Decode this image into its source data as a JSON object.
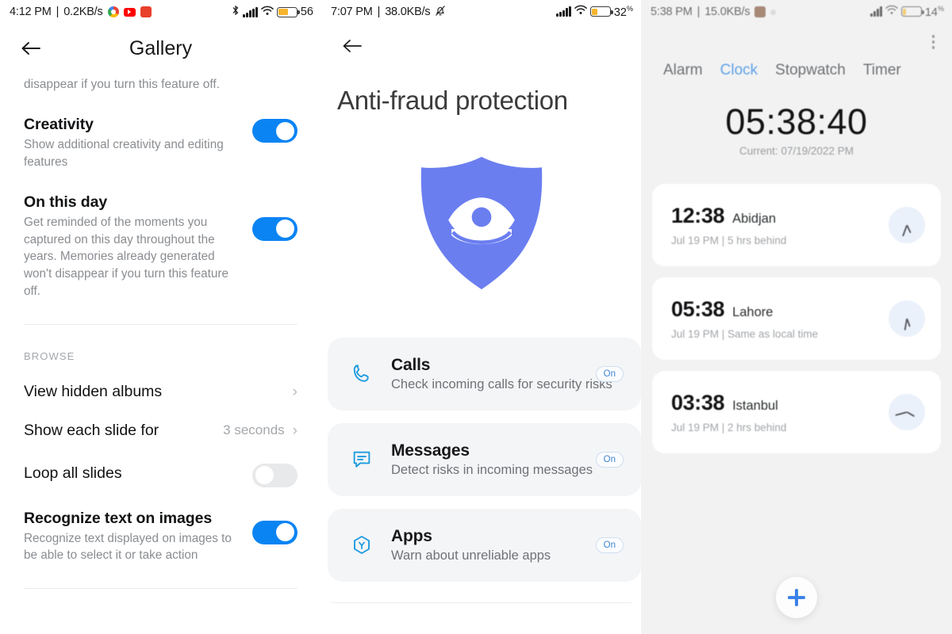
{
  "panel_gallery": {
    "status_bar": {
      "time": "4:12 PM",
      "separator": "|",
      "net_speed": "0.2KB/s",
      "app_icons": [
        "chrome-icon",
        "youtube-icon",
        "red-app-icon"
      ],
      "bluetooth_icon": "bluetooth-icon",
      "signal_icon": "signal-bars-icon",
      "wifi_icon": "wifi-icon",
      "battery_icon": "battery-icon",
      "battery_percent": "56"
    },
    "app_bar": {
      "back_icon": "back-arrow-icon",
      "title": "Gallery"
    },
    "lead_text": "disappear if you turn this feature off.",
    "settings": [
      {
        "title": "Creativity",
        "subtitle": "Show additional creativity and editing features",
        "toggle": "on"
      },
      {
        "title": "On this day",
        "subtitle": "Get reminded of the moments you captured on this day throughout the years. Memories already generated won't disappear if you turn this feature off.",
        "toggle": "on"
      }
    ],
    "section_label": "BROWSE",
    "browse_rows": [
      {
        "title": "View hidden albums",
        "value": "",
        "chevron": "›",
        "type": "nav"
      },
      {
        "title": "Show each slide for",
        "value": "3 seconds",
        "chevron": "›",
        "type": "nav"
      },
      {
        "title": "Loop all slides",
        "value": "",
        "chevron": "",
        "type": "toggle",
        "toggle": "off"
      }
    ],
    "last_setting": {
      "title": "Recognize text on images",
      "subtitle": "Recognize text displayed on images to be able to select it or take action",
      "toggle": "on"
    }
  },
  "panel_antifraud": {
    "status_bar": {
      "time": "7:07 PM",
      "separator": "|",
      "net_speed": "38.0KB/s",
      "mute_icon": "bell-muted-icon",
      "signal_icon": "signal-bars-icon",
      "wifi_icon": "wifi-icon",
      "battery_icon": "battery-icon",
      "battery_percent": "32",
      "percent_symbol": "%"
    },
    "app_bar": {
      "back_icon": "back-arrow-icon"
    },
    "title": "Anti-fraud protection",
    "hero_icon": "shield-eye-icon",
    "hero_color": "#6b7ef0",
    "cards": [
      {
        "icon": "phone-icon",
        "title": "Calls",
        "subtitle": "Check incoming calls for security risks",
        "status": "On"
      },
      {
        "icon": "message-icon",
        "title": "Messages",
        "subtitle": "Detect risks in incoming messages",
        "status": "On"
      },
      {
        "icon": "apps-hexagon-icon",
        "title": "Apps",
        "subtitle": "Warn about unreliable apps",
        "status": "On"
      }
    ]
  },
  "panel_clock": {
    "status_bar": {
      "time": "5:38 PM",
      "separator": "|",
      "net_speed": "15.0KB/s",
      "app_icon": "brown-app-icon",
      "signal_icon": "signal-bars-icon",
      "wifi_icon": "wifi-icon",
      "battery_icon": "battery-icon",
      "battery_percent": "14",
      "percent_symbol": "%"
    },
    "menu_icon": "kebab-menu-icon",
    "tabs": [
      {
        "label": "Alarm",
        "active": false
      },
      {
        "label": "Clock",
        "active": true
      },
      {
        "label": "Stopwatch",
        "active": false
      },
      {
        "label": "Timer",
        "active": false
      }
    ],
    "active_tab_color": "#5fa2e8",
    "clock": {
      "time": "05:38:40",
      "current": "Current: 07/19/2022 PM"
    },
    "world_clocks": [
      {
        "time": "12:38",
        "city": "Abidjan",
        "meta": "Jul 19 PM  |  5 hrs behind",
        "dial_icon": "analog-clock-icon"
      },
      {
        "time": "05:38",
        "city": "Lahore",
        "meta": "Jul 19 PM  |  Same as local time",
        "dial_icon": "analog-clock-icon"
      },
      {
        "time": "03:38",
        "city": "Istanbul",
        "meta": "Jul 19 PM  |  2 hrs behind",
        "dial_icon": "analog-clock-icon"
      }
    ],
    "fab": {
      "icon": "plus-icon",
      "color": "#3b82e8"
    }
  }
}
